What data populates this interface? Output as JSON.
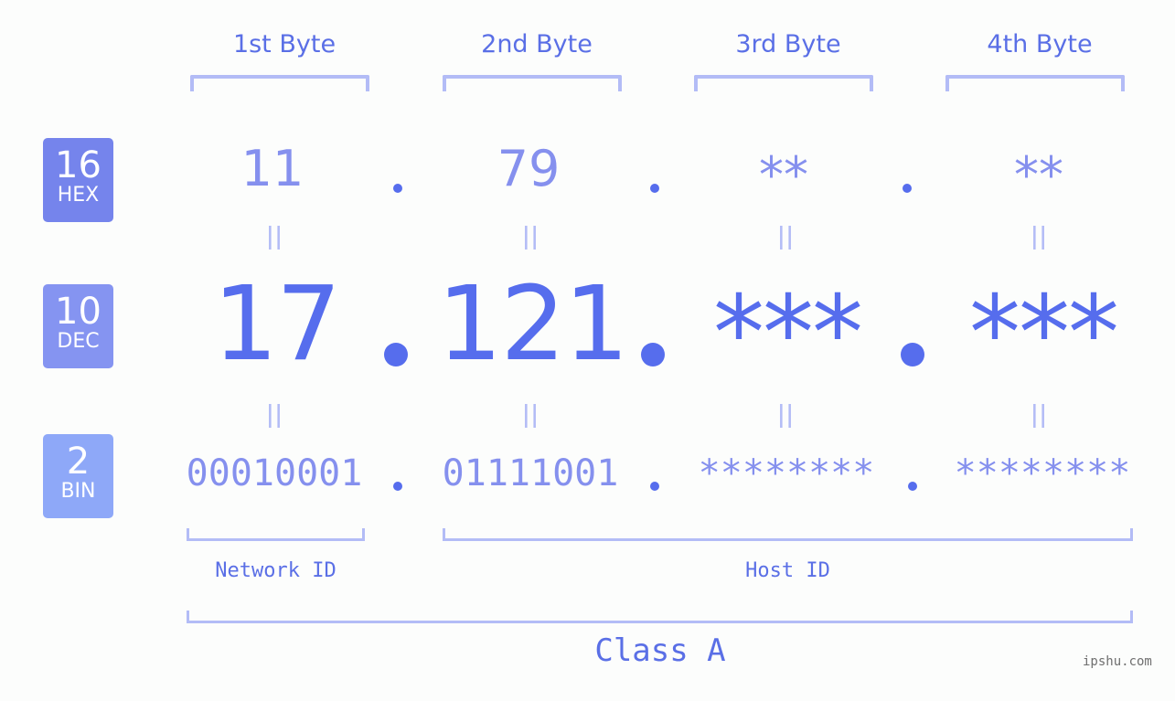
{
  "bytes": [
    {
      "title": "1st Byte",
      "hex": "11",
      "dec": "17",
      "bin": "00010001"
    },
    {
      "title": "2nd Byte",
      "hex": "79",
      "dec": "121",
      "bin": "01111001"
    },
    {
      "title": "3rd Byte",
      "hex": "**",
      "dec": "***",
      "bin": "********"
    },
    {
      "title": "4th Byte",
      "hex": "**",
      "dec": "***",
      "bin": "********"
    }
  ],
  "badges": {
    "hex": {
      "num": "16",
      "label": "HEX",
      "color": "#7584ec"
    },
    "dec": {
      "num": "10",
      "label": "DEC",
      "color": "#8594f1"
    },
    "bin": {
      "num": "2",
      "label": "BIN",
      "color": "#8ea8f8"
    }
  },
  "separator": ".",
  "equals": "=",
  "network_id_label": "Network ID",
  "host_id_label": "Host ID",
  "class_label": "Class A",
  "watermark": "ipshu.com",
  "colors": {
    "accent": "#566ded",
    "light": "#8590ee",
    "bracket": "#b3bcf6",
    "background": "#fcfdfc"
  }
}
